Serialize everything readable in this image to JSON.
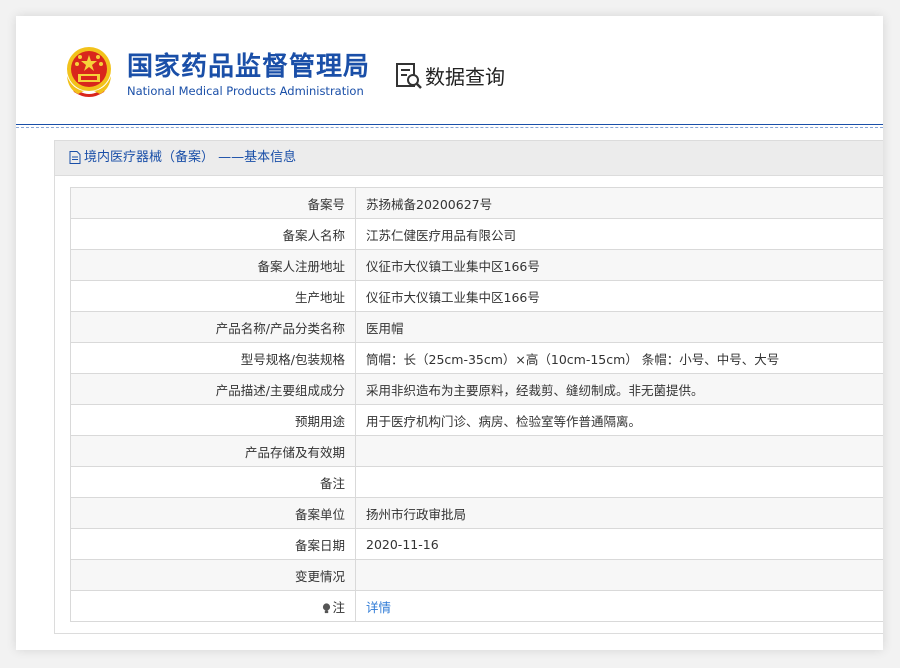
{
  "header": {
    "org_cn": "国家药品监督管理局",
    "org_en": "National Medical Products Administration",
    "query_title": "数据查询",
    "brand_color": "#1a4fa8"
  },
  "panel": {
    "title": "境内医疗器械（备案） ——基本信息"
  },
  "rows": [
    {
      "label": "备案号",
      "value": "苏扬械备20200627号"
    },
    {
      "label": "备案人名称",
      "value": "江苏仁健医疗用品有限公司"
    },
    {
      "label": "备案人注册地址",
      "value": "仪征市大仪镇工业集中区166号"
    },
    {
      "label": "生产地址",
      "value": "仪征市大仪镇工业集中区166号"
    },
    {
      "label": "产品名称/产品分类名称",
      "value": "医用帽"
    },
    {
      "label": "型号规格/包装规格",
      "value": "筒帽：长（25cm-35cm）×高（10cm-15cm） 条帽：小号、中号、大号"
    },
    {
      "label": "产品描述/主要组成成分",
      "value": "采用非织造布为主要原料，经裁剪、缝纫制成。非无菌提供。"
    },
    {
      "label": "预期用途",
      "value": "用于医疗机构门诊、病房、检验室等作普通隔离。"
    },
    {
      "label": "产品存储及有效期",
      "value": ""
    },
    {
      "label": "备注",
      "value": ""
    },
    {
      "label": "备案单位",
      "value": "扬州市行政审批局"
    },
    {
      "label": "备案日期",
      "value": "2020-11-16"
    },
    {
      "label": "变更情况",
      "value": ""
    },
    {
      "label": "注",
      "value": "详情"
    }
  ]
}
